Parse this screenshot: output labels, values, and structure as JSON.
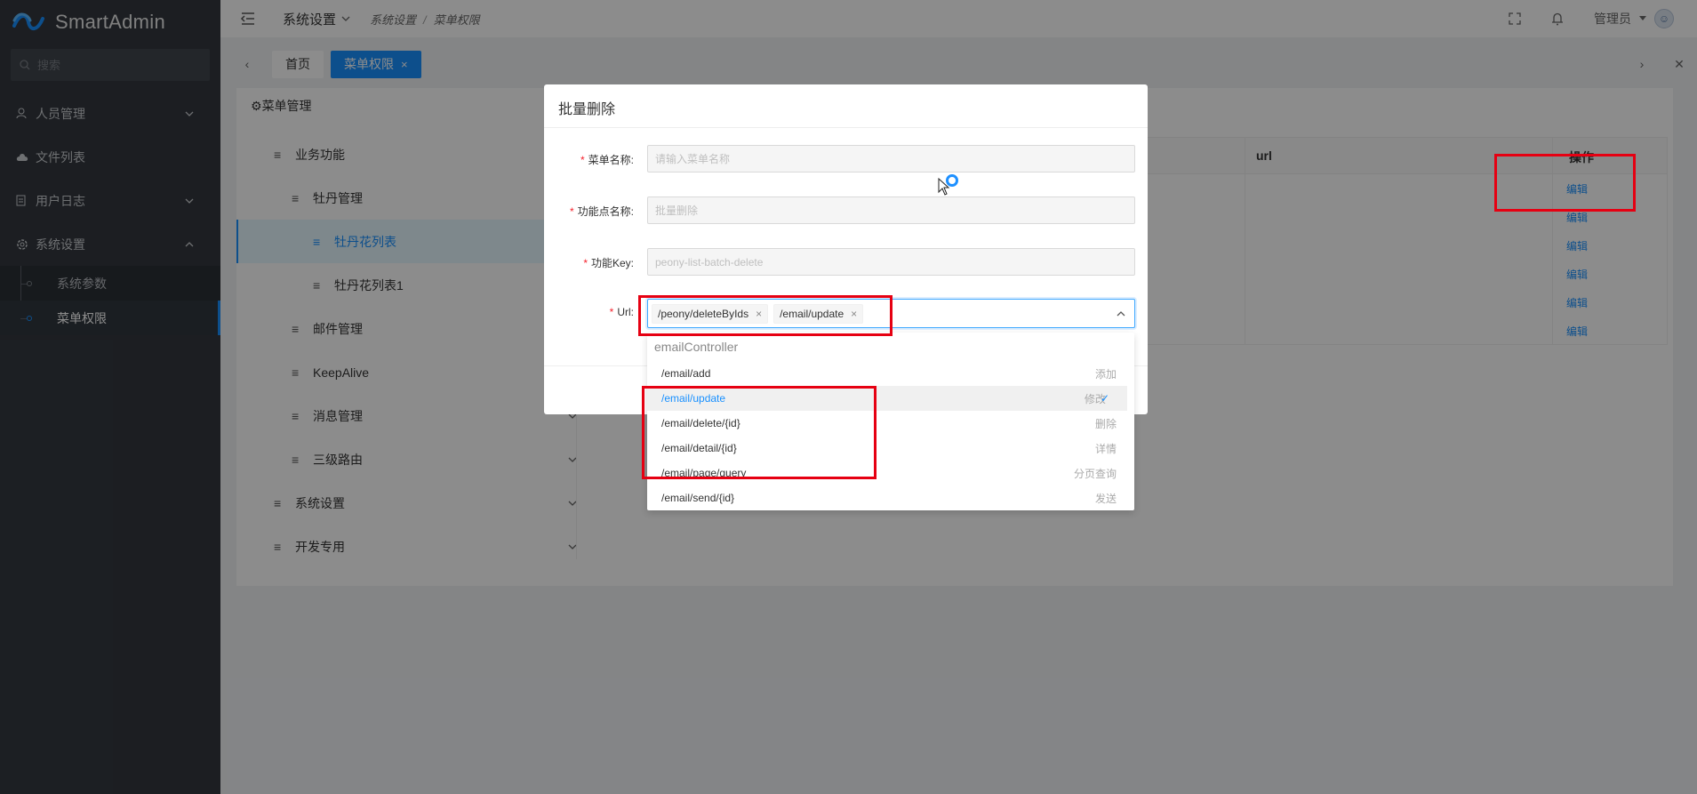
{
  "app": {
    "name": "SmartAdmin"
  },
  "sidebar": {
    "search_placeholder": "搜索",
    "items": [
      {
        "label": "人员管理",
        "icon": "user-icon",
        "expanded": false
      },
      {
        "label": "文件列表",
        "icon": "cloud-icon"
      },
      {
        "label": "用户日志",
        "icon": "document-icon",
        "expanded": false
      },
      {
        "label": "系统设置",
        "icon": "settings-icon",
        "expanded": true,
        "children": [
          {
            "label": "系统参数"
          },
          {
            "label": "菜单权限",
            "active": true
          }
        ]
      }
    ]
  },
  "header": {
    "menu_label": "系统设置",
    "breadcrumb": [
      "系统设置",
      "菜单权限"
    ],
    "user_name": "管理员"
  },
  "tabs": [
    {
      "label": "首页",
      "active": false
    },
    {
      "label": "菜单权限",
      "active": true,
      "close": "×"
    }
  ],
  "content": {
    "title": "菜单管理",
    "tree": [
      {
        "label": "业务功能",
        "level": 0
      },
      {
        "label": "牡丹管理",
        "level": 1
      },
      {
        "label": "牡丹花列表",
        "level": 2,
        "selected": true
      },
      {
        "label": "牡丹花列表1",
        "level": 2
      },
      {
        "label": "邮件管理",
        "level": 1
      },
      {
        "label": "KeepAlive",
        "level": 1
      },
      {
        "label": "消息管理",
        "level": 1
      },
      {
        "label": "三级路由",
        "level": 1
      },
      {
        "label": "系统设置",
        "level": 0
      },
      {
        "label": "开发专用",
        "level": 0
      }
    ],
    "table": {
      "col_url": "url",
      "col_op": "操作",
      "rows": [
        {
          "op": "编辑"
        },
        {
          "op": "编辑"
        },
        {
          "op": "编辑"
        },
        {
          "op": "编辑"
        },
        {
          "op": "编辑"
        },
        {
          "op": "编辑"
        }
      ]
    }
  },
  "modal": {
    "title": "批量删除",
    "fields": {
      "menu_name": {
        "label": "菜单名称:",
        "placeholder": "请输入菜单名称"
      },
      "func_name": {
        "label": "功能点名称:",
        "value": "批量删除"
      },
      "func_key": {
        "label": "功能Key:",
        "value": "peony-list-batch-delete"
      },
      "url": {
        "label": "Url:",
        "tags": [
          "/peony/deleteByIds",
          "/email/update"
        ],
        "tag_close": "×"
      }
    }
  },
  "dropdown": {
    "group": "emailController",
    "options": [
      {
        "url": "/email/add",
        "desc": "添加"
      },
      {
        "url": "/email/update",
        "desc": "修改",
        "selected": true,
        "check": "✓"
      },
      {
        "url": "/email/delete/{id}",
        "desc": "删除"
      },
      {
        "url": "/email/detail/{id}",
        "desc": "详情"
      },
      {
        "url": "/email/page/query",
        "desc": "分页查询"
      },
      {
        "url": "/email/send/{id}",
        "desc": "发送"
      }
    ]
  },
  "colors": {
    "primary": "#1890ff",
    "sidebar_bg": "#33383f",
    "highlight": "#e60012",
    "required": "#f5222d"
  }
}
